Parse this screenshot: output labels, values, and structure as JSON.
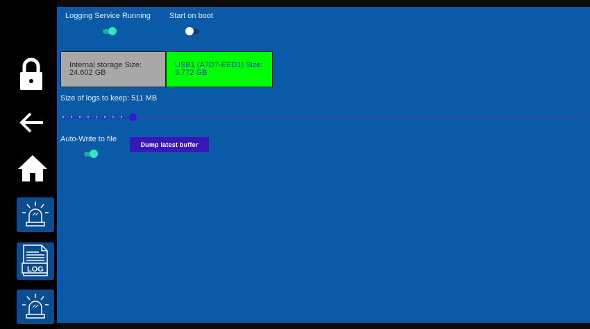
{
  "top": {
    "logging_label": "Logging Service Running",
    "logging_on": true,
    "boot_label": "Start on boot",
    "boot_on": false
  },
  "storage": {
    "internal_label": "Internal storage Size:",
    "internal_value": "24.602 GB",
    "usb_label": "USB1 (A7D7-EED1) Size:",
    "usb_value": "3.772 GB"
  },
  "logs": {
    "size_label": "Size of logs to keep: 511 MB"
  },
  "autowrite": {
    "label": "Auto-Write to file",
    "on": true
  },
  "dump_button": "Dump latest buffer",
  "sidebar": {
    "log_tile_text": "LOG",
    "icons": [
      "lock-icon",
      "back-arrow-icon",
      "home-icon",
      "alarm-siren-icon",
      "log-file-icon",
      "alarm-siren-icon"
    ]
  },
  "colors": {
    "main_bg": "#0a5aa8",
    "toggle_on": "#31e6c8",
    "usb_bg": "#00ff00",
    "button_bg": "#3a16b8"
  }
}
